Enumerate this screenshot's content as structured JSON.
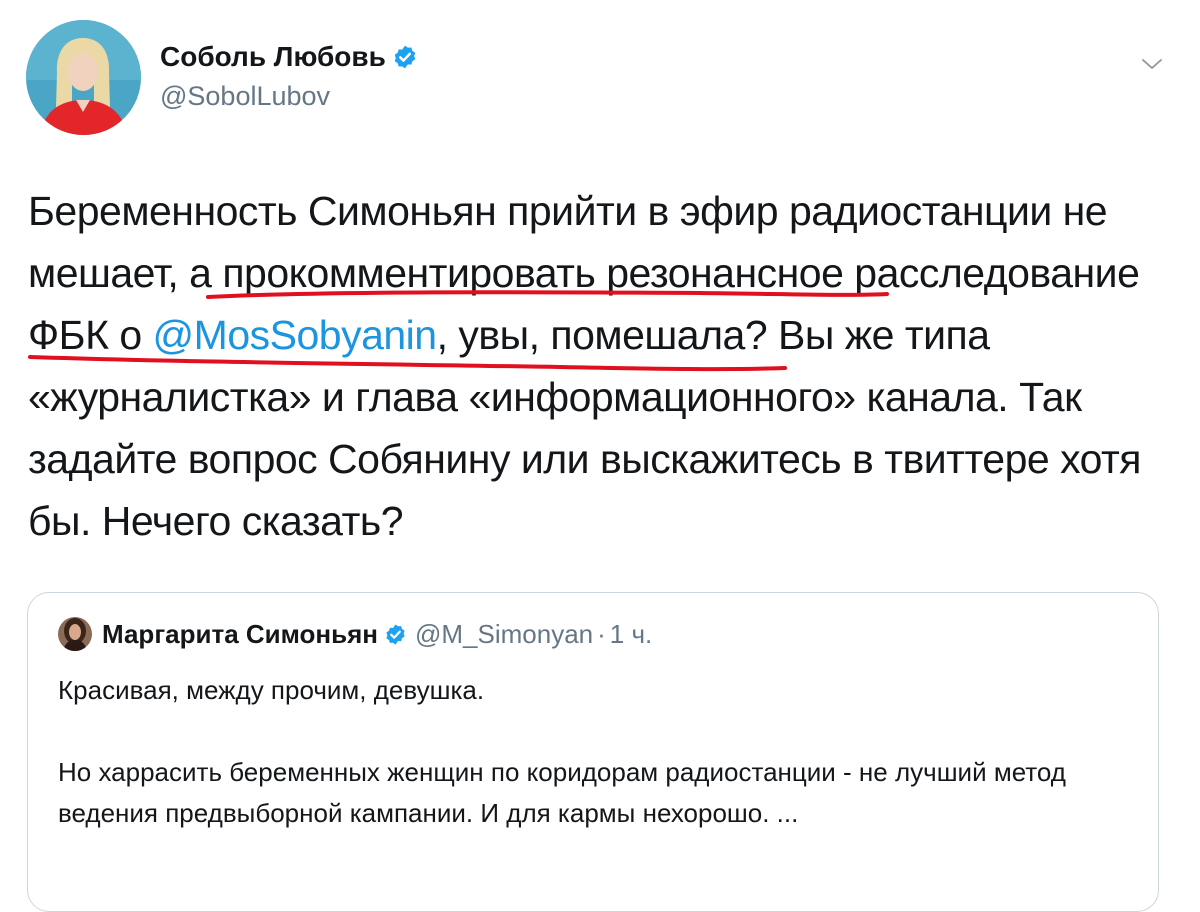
{
  "author": {
    "name": "Соболь Любовь",
    "handle": "@SobolLubov"
  },
  "tweet": {
    "text_part1": "Беременность Симоньян прийти в эфир радиостанции не мешает, а прокомментировать резонансное расследование ФБК о ",
    "mention": "@MosSobyanin",
    "text_part2": ", увы, помешала? Вы же типа «журналистка» и глава «информационного» канала. Так задайте вопрос Собянину или выскажитесь в твиттере хотя бы. Нечего сказать?"
  },
  "quoted_tweet": {
    "name": "Маргарита Симоньян",
    "handle": "@M_Simonyan",
    "separator": "·",
    "time": "1 ч.",
    "paragraph1": "Красивая, между прочим, девушка.",
    "paragraph2": "Но харрасить беременных женщин по коридорам радиостанции - не лучший метод ведения предвыборной кампании. И для кармы нехорошо. ..."
  },
  "colors": {
    "link": "#1b95e0",
    "verified_badge": "#1da1f2",
    "secondary_text": "#657786",
    "border": "#ccd6dd",
    "annotation_underline": "#e0101e"
  },
  "icons": [
    "verified-badge-icon",
    "chevron-down-icon"
  ]
}
